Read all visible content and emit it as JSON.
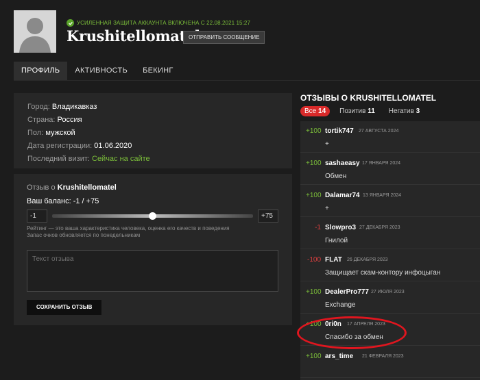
{
  "profile": {
    "security_notice": "Усиленная защита аккаунта включена с 22.08.2021 15:27",
    "username": "Krushitellomatel",
    "message_button": "Отправить сообщение"
  },
  "tabs": [
    {
      "label": "Профиль",
      "active": true
    },
    {
      "label": "Активность",
      "active": false
    },
    {
      "label": "Бекинг",
      "active": false
    }
  ],
  "info": {
    "city_key": "Город:",
    "city": "Владикавказ",
    "country_key": "Страна:",
    "country": "Россия",
    "gender_key": "Пол:",
    "gender": "мужской",
    "reg_key": "Дата регистрации:",
    "reg": "01.06.2020",
    "visit_key": "Последний визит:",
    "visit": "Сейчас на сайте"
  },
  "review_form": {
    "title_prefix": "Отзыв о ",
    "title_name": "Krushitellomatel",
    "balance": "Ваш баланс: -1 / +75",
    "min": "-1",
    "max": "+75",
    "slider_fraction": 0.5,
    "hint_line1": "Рейтинг — это ваша характеристика человека, оценка его качеств и поведения",
    "hint_line2": "Запас очков обновляется по понедельникам",
    "placeholder": "Текст отзыва",
    "save_button": "Сохранить отзыв"
  },
  "reviews": {
    "title": "Отзывы о Krushitellomatel",
    "filters": [
      {
        "label": "Все",
        "count": "14",
        "active": true
      },
      {
        "label": "Позитив",
        "count": "11",
        "active": false
      },
      {
        "label": "Негатив",
        "count": "3",
        "active": false
      }
    ],
    "items": [
      {
        "score": "+100",
        "type": "pos",
        "author": "tortik747",
        "date": "27 августа 2024",
        "text": "+"
      },
      {
        "score": "+100",
        "type": "pos",
        "author": "sashaeasy",
        "date": "17 января 2024",
        "text": "Обмен"
      },
      {
        "score": "+100",
        "type": "pos",
        "author": "Dalamar74",
        "date": "13 января 2024",
        "text": "+"
      },
      {
        "score": "-1",
        "type": "neg",
        "author": "Slowpro3",
        "date": "27 декабря 2023",
        "text": "Гнилой"
      },
      {
        "score": "-100",
        "type": "neg",
        "author": "FLAT",
        "date": "26 декабря 2023",
        "text": "Защищает скам-контору инфоцыган"
      },
      {
        "score": "+100",
        "type": "pos",
        "author": "DealerPro777",
        "date": "27 июля 2023",
        "text": "Exchange"
      },
      {
        "score": "+100",
        "type": "pos",
        "author": "0ri0n",
        "date": "17 апреля 2023",
        "text": "Спасибо за обмен"
      },
      {
        "score": "+100",
        "type": "pos",
        "author": "ars_time",
        "date": "21 февраля 2023",
        "text": ""
      }
    ]
  },
  "colors": {
    "positive": "#7cbf3a",
    "negative": "#e04040",
    "accent_red": "#d92a2a",
    "highlight_circle": "#e0161f"
  }
}
